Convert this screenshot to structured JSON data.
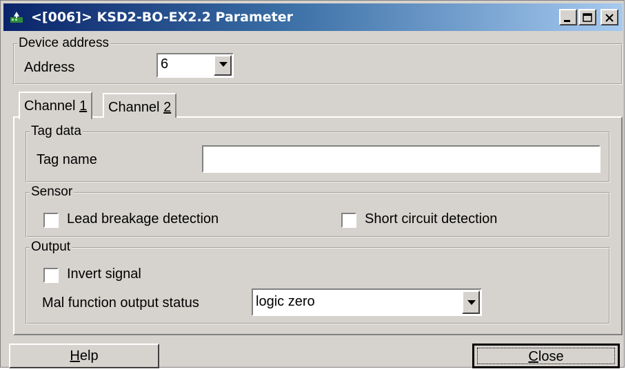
{
  "window": {
    "title": "<[006]> KSD2-BO-EX2.2 Parameter",
    "icon": "device-network-icon",
    "buttons": [
      "minimize-icon",
      "maximize-icon",
      "close-icon"
    ]
  },
  "device_address": {
    "group_label": "Device address",
    "address_label": "Address",
    "address_value": "6"
  },
  "tabs": [
    {
      "label": "Channel 1",
      "prefix": "Channel ",
      "mnemonic": "1",
      "active": true
    },
    {
      "label": "Channel 2",
      "prefix": "Channel ",
      "mnemonic": "2",
      "active": false
    }
  ],
  "tag_data": {
    "group_label": "Tag data",
    "tag_name_label": "Tag name",
    "tag_name_value": ""
  },
  "sensor": {
    "group_label": "Sensor",
    "lead_breakage_label": "Lead breakage detection",
    "lead_breakage_checked": false,
    "short_circuit_label": "Short circuit detection",
    "short_circuit_checked": false
  },
  "output": {
    "group_label": "Output",
    "invert_signal_label": "Invert signal",
    "invert_signal_checked": false,
    "malfunction_label": "Mal function output status",
    "malfunction_value": "logic zero"
  },
  "footer": {
    "help_label": "Help",
    "help_mnemonic": "H",
    "help_rest": "elp",
    "close_label": "Close",
    "close_mnemonic": "C",
    "close_rest": "lose"
  },
  "colors": {
    "face": "#d6d3ce",
    "title_start": "#0a246a",
    "title_end": "#a6caf0"
  }
}
